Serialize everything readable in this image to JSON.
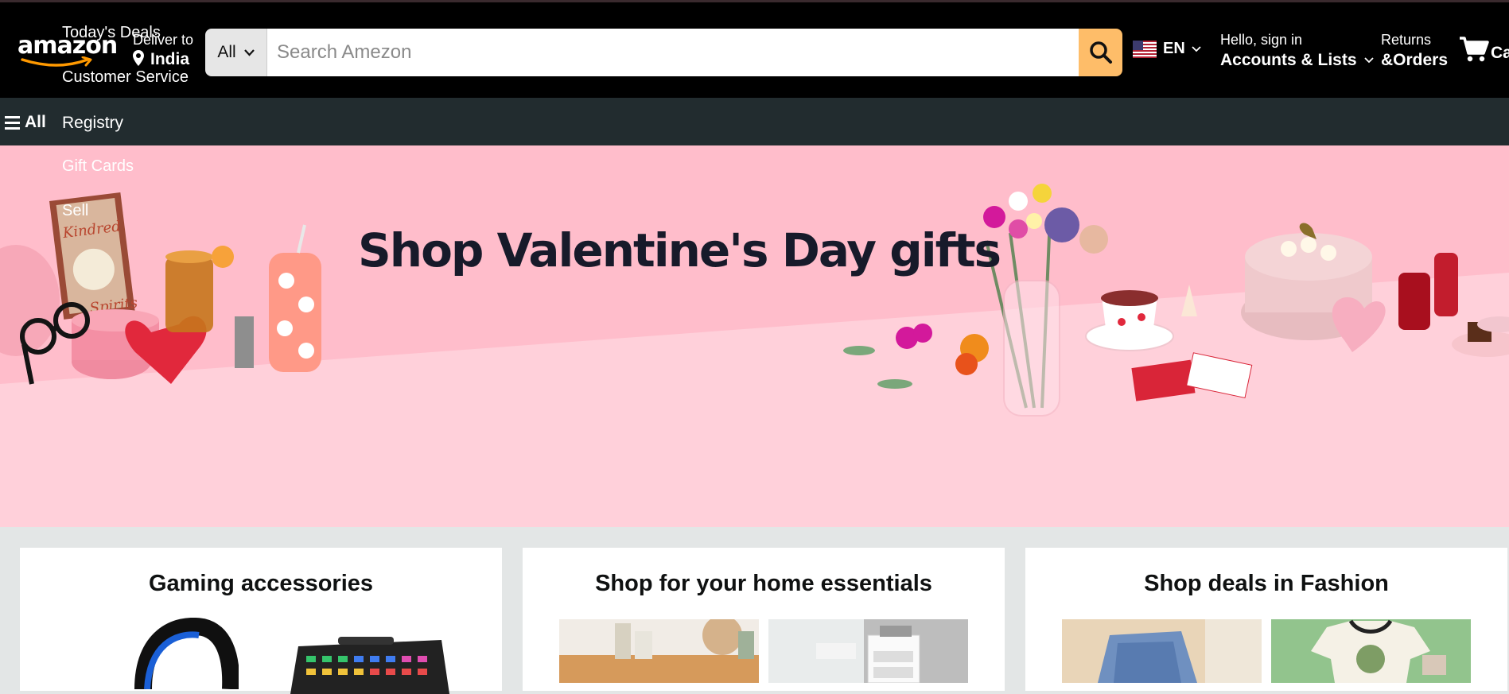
{
  "header": {
    "logo_text": "amazon",
    "deliver_label": "Deliver to",
    "deliver_location": "India",
    "overlay_links": [
      "Today's Deals",
      "Customer Service",
      "Gift Cards",
      "Sell"
    ],
    "search": {
      "category": "All",
      "placeholder": "Search Amezon",
      "value": ""
    },
    "language_code": "EN",
    "greeting": "Hello, sign in",
    "accounts_label": "Accounts & Lists",
    "returns_label": "Returns",
    "orders_label": "&Orders",
    "cart_label": "Cart"
  },
  "nav": {
    "all_label": "All",
    "items": [
      "Registry"
    ]
  },
  "hero": {
    "title": "Shop Valentine's Day gifts",
    "book_title_line1": "Kindred",
    "book_title_line2": "Spirits"
  },
  "cards": [
    {
      "title": "Gaming accessories"
    },
    {
      "title": "Shop for your home essentials"
    },
    {
      "title": "Shop deals in Fashion"
    }
  ],
  "colors": {
    "header_bg": "#000000",
    "nav_bg": "#222c2f",
    "search_button": "#febd69",
    "hero_bg": "#ffbdcb",
    "page_bg": "#e3e6e6"
  },
  "icons": [
    "amazon-smile-icon",
    "location-pin-icon",
    "chevron-down-icon",
    "search-icon",
    "us-flag-icon",
    "cart-icon",
    "hamburger-icon"
  ]
}
